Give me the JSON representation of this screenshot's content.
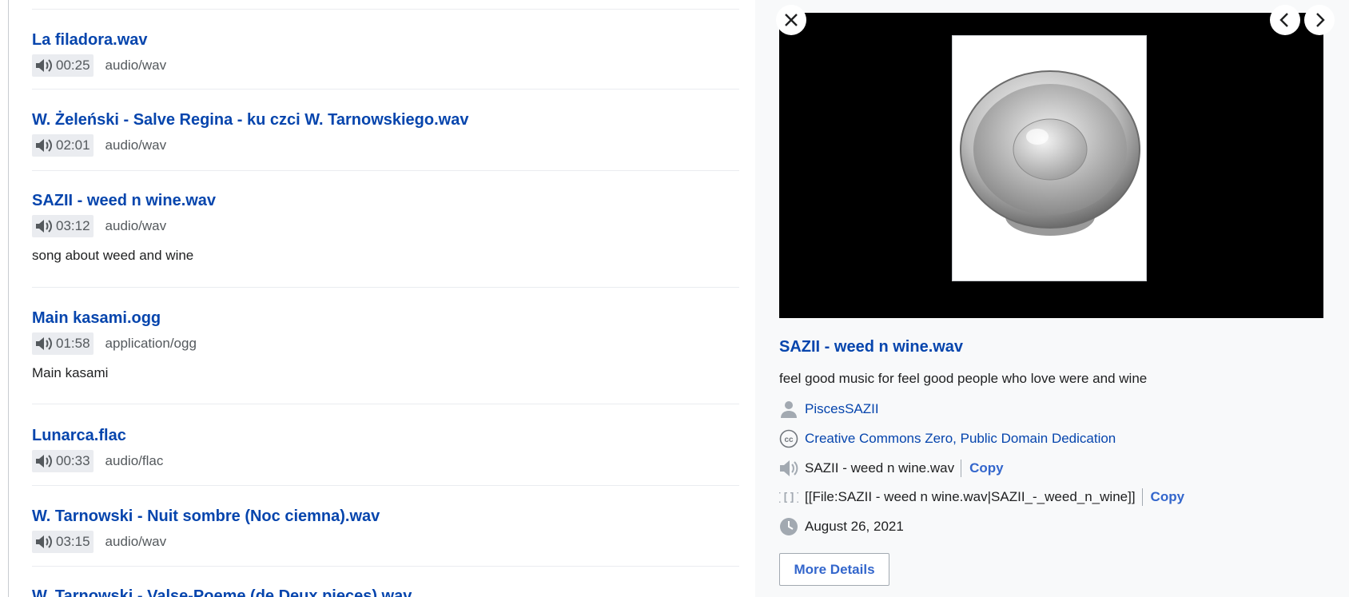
{
  "results": [
    {
      "title": "La filadora.wav",
      "duration": "00:25",
      "mime": "audio/wav",
      "description": ""
    },
    {
      "title": "W. Żeleński - Salve Regina - ku czci W. Tarnowskiego.wav",
      "duration": "02:01",
      "mime": "audio/wav",
      "description": ""
    },
    {
      "title": "SAZII - weed n wine.wav",
      "duration": "03:12",
      "mime": "audio/wav",
      "description": "song about weed and wine"
    },
    {
      "title": "Main kasami.ogg",
      "duration": "01:58",
      "mime": "application/ogg",
      "description": "Main kasami"
    },
    {
      "title": "Lunarca.flac",
      "duration": "00:33",
      "mime": "audio/flac",
      "description": ""
    },
    {
      "title": "W. Tarnowski - Nuit sombre (Noc ciemna).wav",
      "duration": "03:15",
      "mime": "audio/wav",
      "description": ""
    },
    {
      "title": "W. Tarnowski - Valse-Poeme (de Deux pieces).wav",
      "duration": "",
      "mime": "",
      "description": ""
    }
  ],
  "panel": {
    "title": "SAZII - weed n wine.wav",
    "description": "feel good music for feel good people who love were and wine",
    "author": "PiscesSAZII",
    "license": "Creative Commons Zero, Public Domain Dedication",
    "filename": "SAZII - weed n wine.wav",
    "wikitext": "[[File:SAZII - weed n wine.wav|SAZII_-_weed_n_wine]]",
    "copy_label": "Copy",
    "date": "August 26, 2021",
    "more_details_label": "More Details",
    "icons": {
      "close": "close-icon",
      "prev": "chevron-left-icon",
      "next": "chevron-right-icon",
      "author": "user-icon",
      "license": "cc-license-icon",
      "file": "speaker-icon",
      "wikitext": "wikitext-brackets-icon",
      "date": "clock-icon",
      "preview": "speaker-image"
    }
  },
  "colors": {
    "link": "#0645ad",
    "accent": "#3366cc",
    "panel_bg": "#f8f9fa",
    "preview_bg": "#000000"
  }
}
